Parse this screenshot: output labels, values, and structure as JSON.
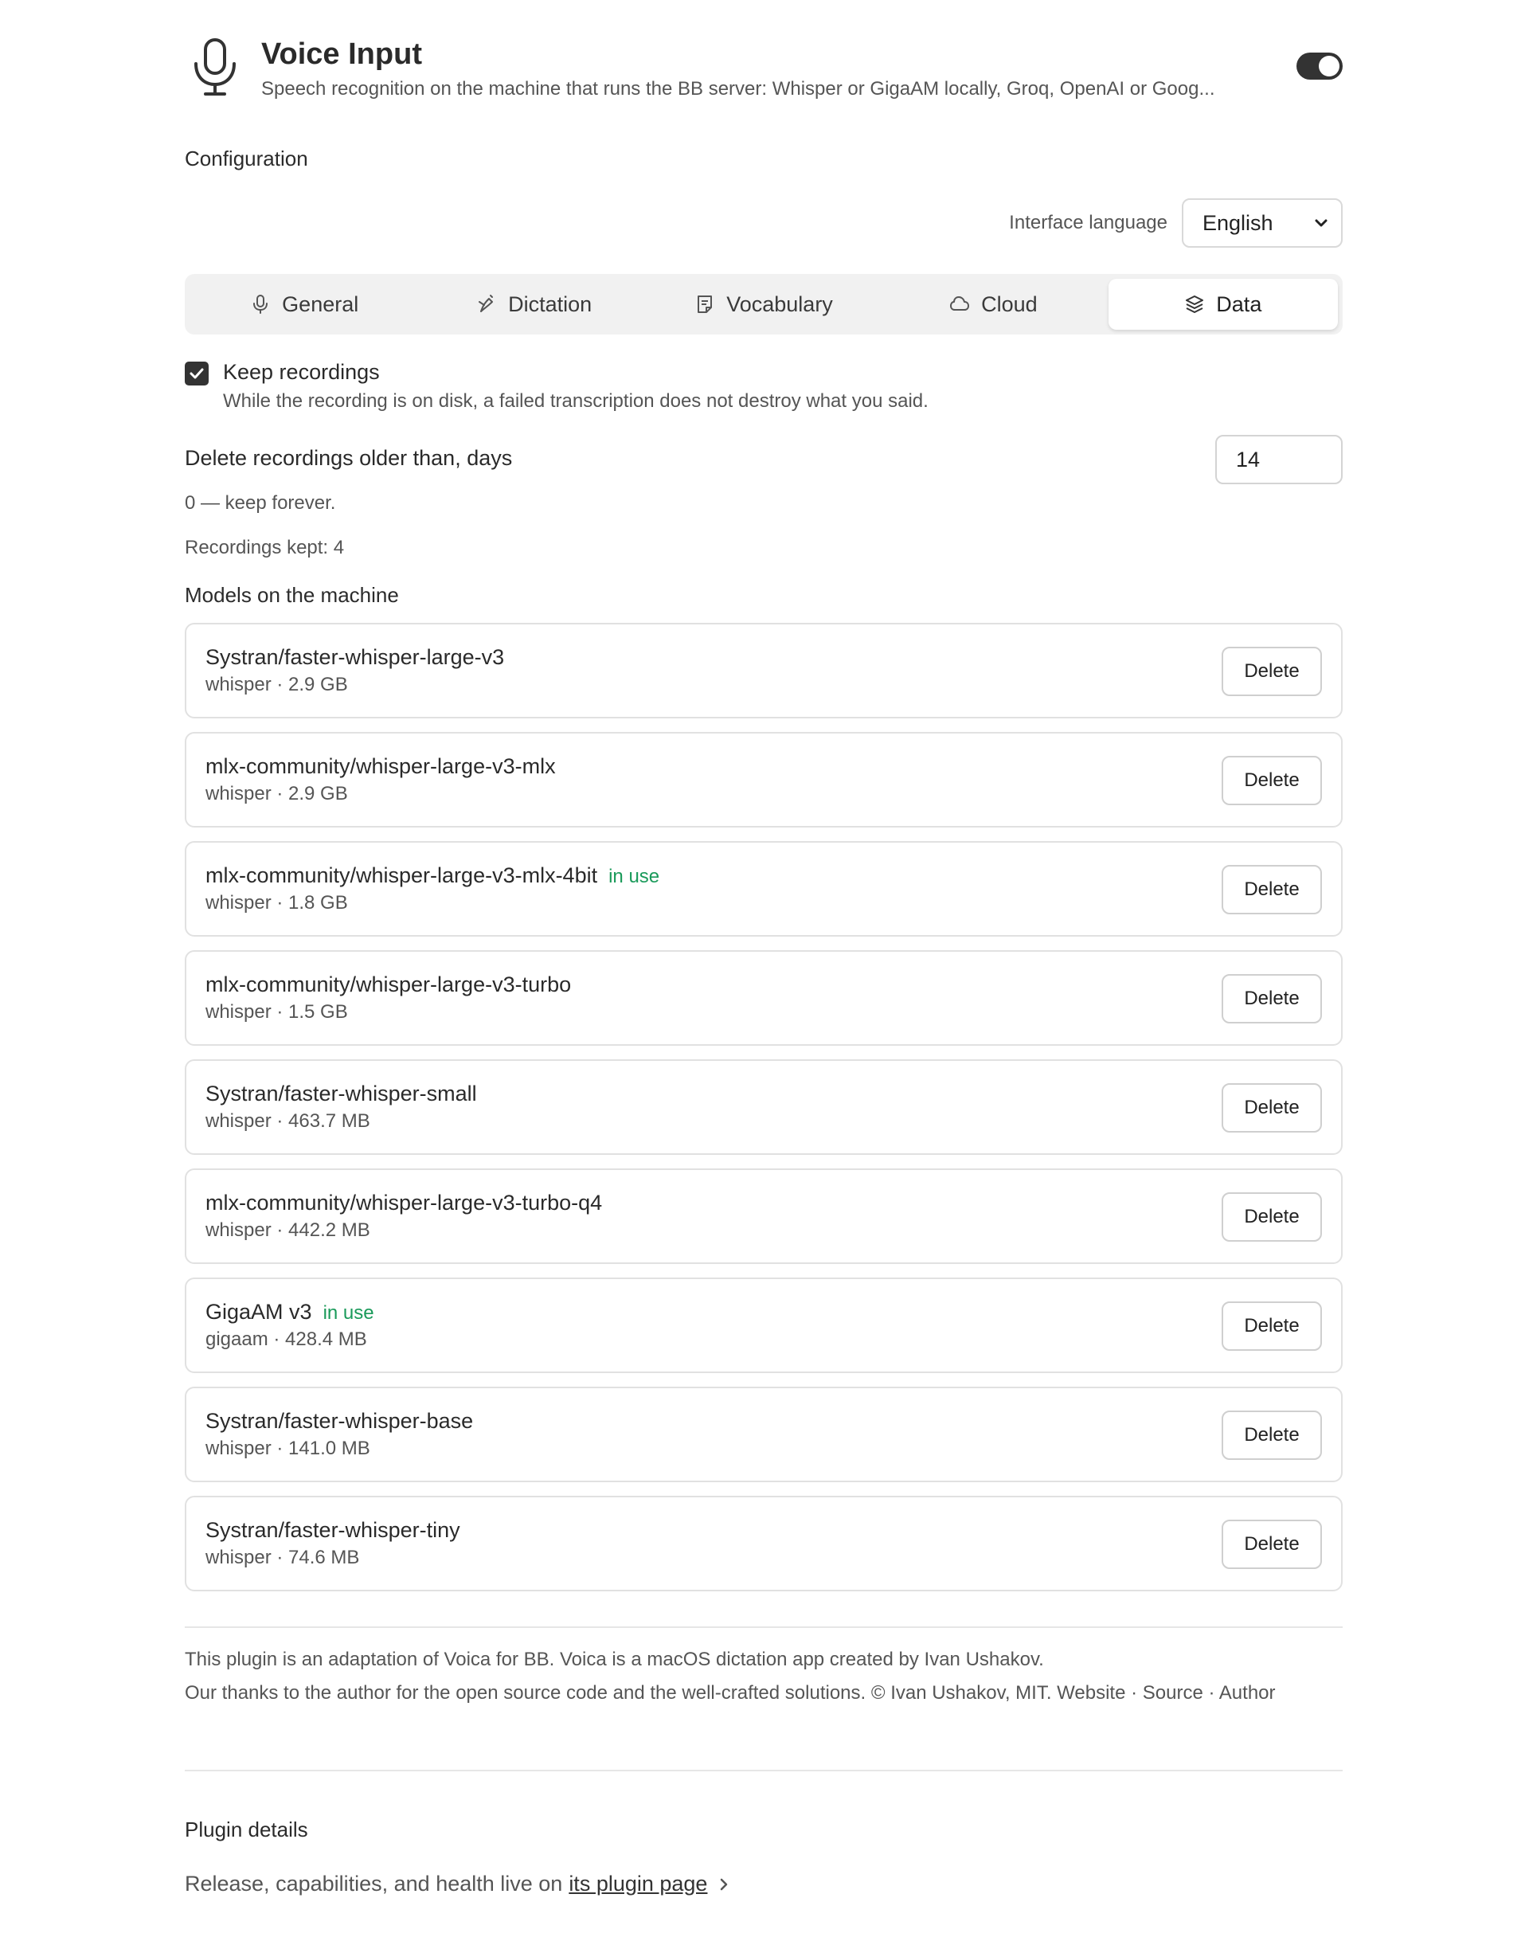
{
  "header": {
    "title": "Voice Input",
    "subtitle": "Speech recognition on the machine that runs the BB server: Whisper or GigaAM locally, Groq, OpenAI or Goog..."
  },
  "configuration": {
    "title": "Configuration",
    "language_label": "Interface language",
    "language_value": "English"
  },
  "tabs": [
    {
      "label": "General",
      "icon": "mic-icon"
    },
    {
      "label": "Dictation",
      "icon": "dictation-icon"
    },
    {
      "label": "Vocabulary",
      "icon": "note-icon"
    },
    {
      "label": "Cloud",
      "icon": "cloud-icon"
    },
    {
      "label": "Data",
      "icon": "layers-icon",
      "active": true
    }
  ],
  "data_tab": {
    "keep_label": "Keep recordings",
    "keep_desc": "While the recording is on disk, a failed transcription does not destroy what you said.",
    "keep_checked": true,
    "delete_label": "Delete recordings older than, days",
    "delete_days": "14",
    "hint": "0 — keep forever.",
    "kept": "Recordings kept: 4",
    "models_title": "Models on the machine",
    "delete_button": "Delete",
    "in_use_label": "in use",
    "models": [
      {
        "name": "Systran/faster-whisper-large-v3",
        "meta": "whisper · 2.9 GB",
        "in_use": false
      },
      {
        "name": "mlx-community/whisper-large-v3-mlx",
        "meta": "whisper · 2.9 GB",
        "in_use": false
      },
      {
        "name": "mlx-community/whisper-large-v3-mlx-4bit",
        "meta": "whisper · 1.8 GB",
        "in_use": true
      },
      {
        "name": "mlx-community/whisper-large-v3-turbo",
        "meta": "whisper · 1.5 GB",
        "in_use": false
      },
      {
        "name": "Systran/faster-whisper-small",
        "meta": "whisper · 463.7 MB",
        "in_use": false
      },
      {
        "name": "mlx-community/whisper-large-v3-turbo-q4",
        "meta": "whisper · 442.2 MB",
        "in_use": false
      },
      {
        "name": "GigaAM v3",
        "meta": "gigaam · 428.4 MB",
        "in_use": true
      },
      {
        "name": "Systran/faster-whisper-base",
        "meta": "whisper · 141.0 MB",
        "in_use": false
      },
      {
        "name": "Systran/faster-whisper-tiny",
        "meta": "whisper · 74.6 MB",
        "in_use": false
      }
    ]
  },
  "footer": {
    "credit1": "This plugin is an adaptation of Voica for BB. Voica is a macOS dictation app created by Ivan Ushakov.",
    "credit2": "Our thanks to the author for the open source code and the well-crafted solutions. © Ivan Ushakov, MIT. Website · Source · Author",
    "plugin_title": "Plugin details",
    "plugin_desc": "Release, capabilities, and health live on",
    "plugin_link": "its plugin page"
  },
  "colors": {
    "accent_dark": "#333333",
    "in_use_green": "#1a9a5a"
  }
}
